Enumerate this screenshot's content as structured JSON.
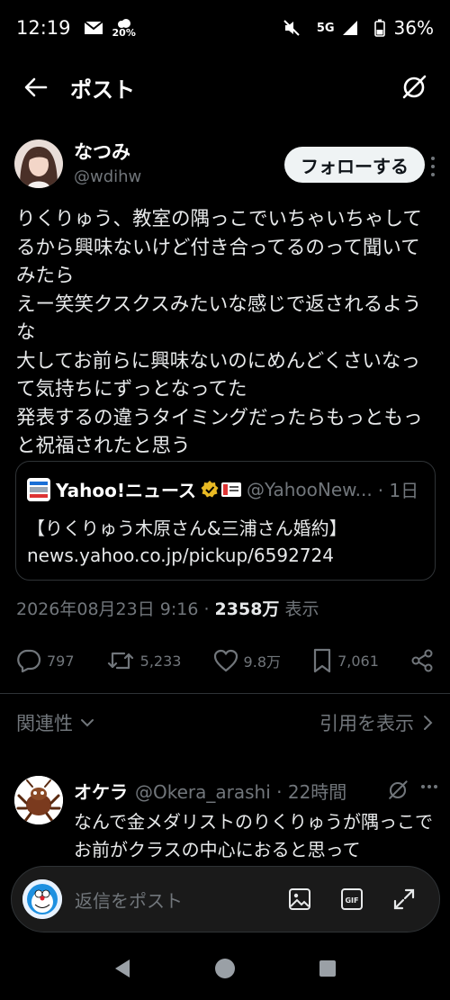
{
  "statusbar": {
    "time": "12:19",
    "badge_top": "20%",
    "network": "5G",
    "battery": "36%"
  },
  "header": {
    "title": "ポスト"
  },
  "post": {
    "author_name": "なつみ",
    "author_handle": "@wdihw",
    "follow_label": "フォローする",
    "text": "りくりゅう、教室の隅っこでいちゃいちゃしてるから興味ないけど付き合ってるのって聞いてみたら\nえー笑笑クスクスみたいな感じで返されるような\n大してお前らに興味ないのにめんどくさいなって気持ちにずっとなってた\n発表するの違うタイミングだったらもっともっと祝福されたと思う",
    "quote": {
      "source_name": "Yahoo!ニュース",
      "source_handle": "@YahooNew...",
      "time": "· 1日",
      "line1": "【りくりゅう木原さん&三浦さん婚約】",
      "line2": "news.yahoo.co.jp/pickup/6592724"
    },
    "meta": {
      "datetime": "2026年08月23日 9:16 · ",
      "views": "2358万",
      "views_label": " 表示"
    },
    "actions": {
      "replies": "797",
      "reposts": "5,233",
      "likes": "9.8万",
      "bookmarks": "7,061"
    }
  },
  "replies_section": {
    "sort_label": "関連性",
    "quotes_label": "引用を表示"
  },
  "reply": {
    "name": "オケラ",
    "handle": "@Okera_arashi · 22時間",
    "text": "なんで金メダリストのりくりゅうが隅っこでお前がクラスの中心におると思って"
  },
  "compose": {
    "placeholder": "返信をポスト",
    "gif_label": "GIF"
  },
  "colors": {
    "background": "#000000",
    "text": "#e7e9ea",
    "secondary": "#71767b",
    "border": "#2f3336",
    "verified_gold": "#e8b923"
  }
}
